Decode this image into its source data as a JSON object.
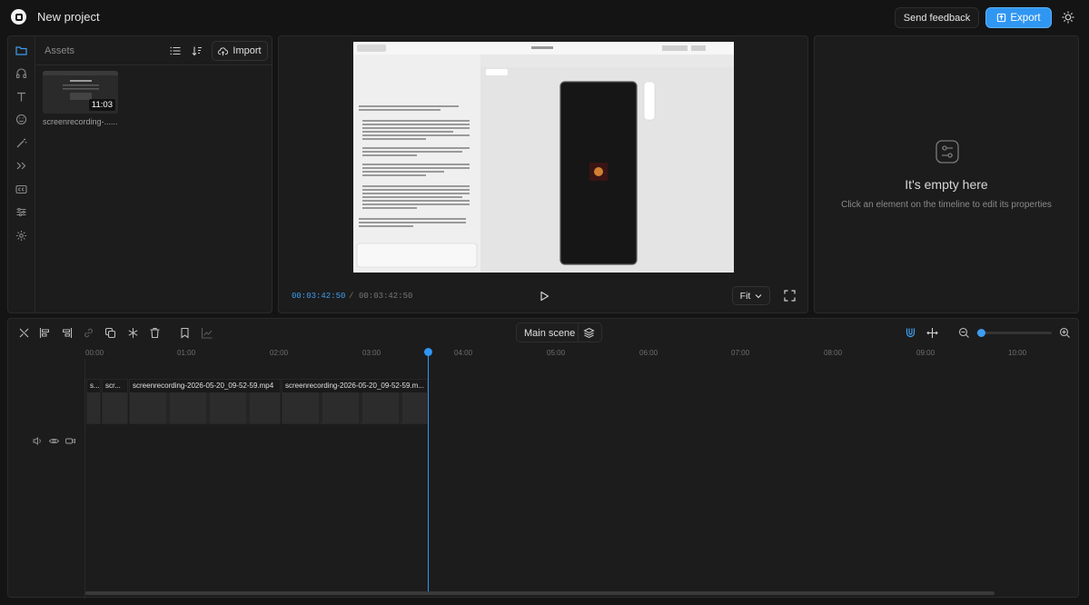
{
  "header": {
    "title": "New project",
    "feedback_label": "Send feedback",
    "export_label": "Export"
  },
  "assets": {
    "label": "Assets",
    "import_label": "Import",
    "items": [
      {
        "name": "screenrecording-2026-05-20_09-52-59.mp4",
        "display_name": "screenrecording-......",
        "duration": "11:03"
      }
    ]
  },
  "preview": {
    "current_time": "00:03:42:50",
    "separator": "/",
    "total_time": "00:03:42:50",
    "fit_label": "Fit"
  },
  "properties": {
    "empty_title": "It's empty here",
    "empty_subtitle": "Click an element on the timeline to edit its properties"
  },
  "timeline": {
    "scene_label": "Main scene",
    "ruler": [
      "00:00",
      "01:00",
      "02:00",
      "03:00",
      "04:00",
      "05:00",
      "06:00",
      "07:00",
      "08:00",
      "09:00",
      "10:00"
    ],
    "clips": [
      {
        "label": "s..."
      },
      {
        "label": "scr..."
      },
      {
        "label": "screenrecording-2026-05-20_09-52-59.mp4"
      },
      {
        "label": "screenrecording-2026-05-20_09-52-59.m..."
      }
    ]
  },
  "colors": {
    "accent": "#2f96f2",
    "background": "#141414",
    "panel": "#1c1c1c"
  }
}
